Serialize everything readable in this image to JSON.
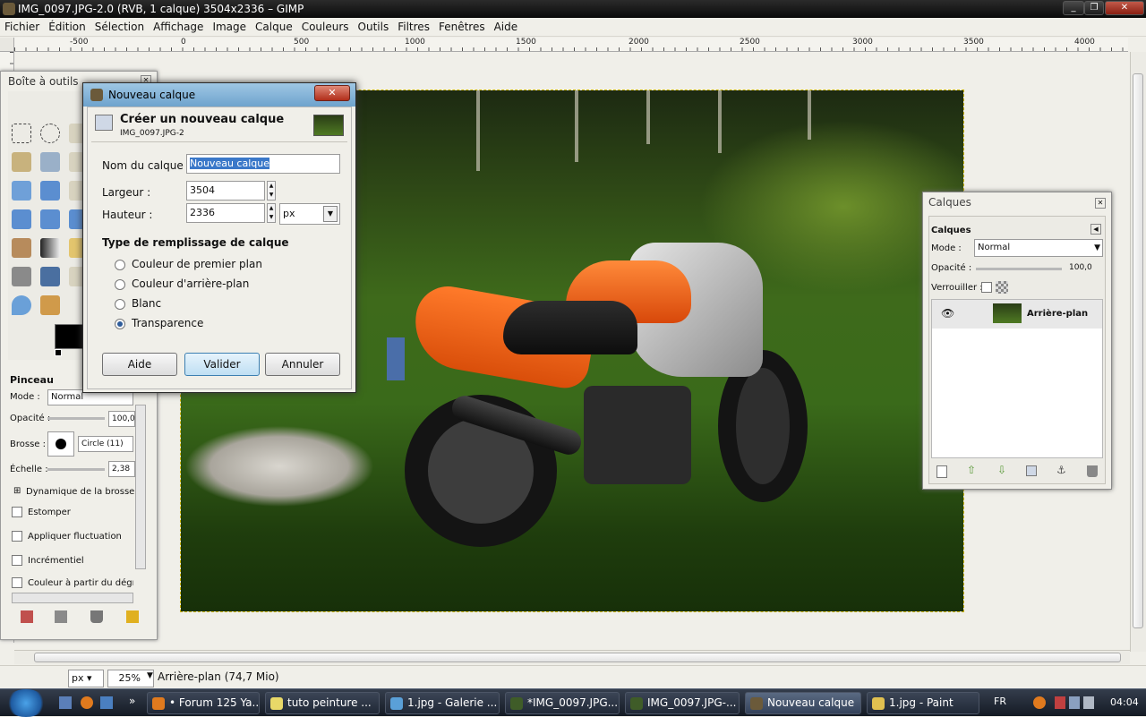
{
  "window": {
    "title": "IMG_0097.JPG-2.0 (RVB, 1 calque) 3504x2336 – GIMP"
  },
  "menu": [
    "Fichier",
    "Édition",
    "Sélection",
    "Affichage",
    "Image",
    "Calque",
    "Couleurs",
    "Outils",
    "Filtres",
    "Fenêtres",
    "Aide"
  ],
  "ruler": {
    "ticks": [
      "-500",
      "0",
      "500",
      "1000",
      "1500",
      "2000",
      "2500",
      "3000",
      "3500",
      "4000"
    ]
  },
  "status": {
    "unit": "px",
    "zoom": "25%",
    "info": "Arrière-plan (74,7 Mio)"
  },
  "toolbox": {
    "title": "Boîte à outils",
    "tool_name": "Pinceau",
    "mode_label": "Mode :",
    "mode_value": "Normal",
    "opacity_label": "Opacité :",
    "opacity_value": "100,0",
    "brush_label": "Brosse :",
    "brush_value": "Circle (11)",
    "scale_label": "Échelle :",
    "scale_value": "2,38",
    "dyn_label": "Dynamique de la brosse",
    "opt_blur": "Estomper",
    "opt_jitter": "Appliquer fluctuation",
    "opt_incr": "Incrémentiel",
    "opt_grad": "Couleur à partir du dégradé"
  },
  "layers": {
    "title": "Calques",
    "tab": "Calques",
    "mode_label": "Mode :",
    "mode_value": "Normal",
    "opacity_label": "Opacité :",
    "opacity_value": "100,0",
    "lock_label": "Verrouiller :",
    "layer_name": "Arrière-plan"
  },
  "dialog": {
    "title": "Nouveau calque",
    "header": "Créer un nouveau calque",
    "subheader": "IMG_0097.JPG-2",
    "name_label": "Nom du calque :",
    "name_value": "Nouveau calque",
    "width_label": "Largeur :",
    "width_value": "3504",
    "height_label": "Hauteur :",
    "height_value": "2336",
    "unit": "px",
    "fill_label": "Type de remplissage de calque",
    "fill_options": [
      "Couleur de premier plan",
      "Couleur d'arrière-plan",
      "Blanc",
      "Transparence"
    ],
    "selected": "Transparence",
    "btn_help": "Aide",
    "btn_ok": "Valider",
    "btn_cancel": "Annuler"
  },
  "taskbar": {
    "items": [
      "• Forum 125 Ya...",
      "tuto peinture ...",
      "1.jpg - Galerie ...",
      "*IMG_0097.JPG...",
      "IMG_0097.JPG-...",
      "Nouveau calque",
      "1.jpg - Paint"
    ],
    "lang": "FR",
    "time": "04:04"
  },
  "colors": {
    "accent": "#3a6ea5",
    "fg": "#000000",
    "bg": "#ffffff"
  }
}
